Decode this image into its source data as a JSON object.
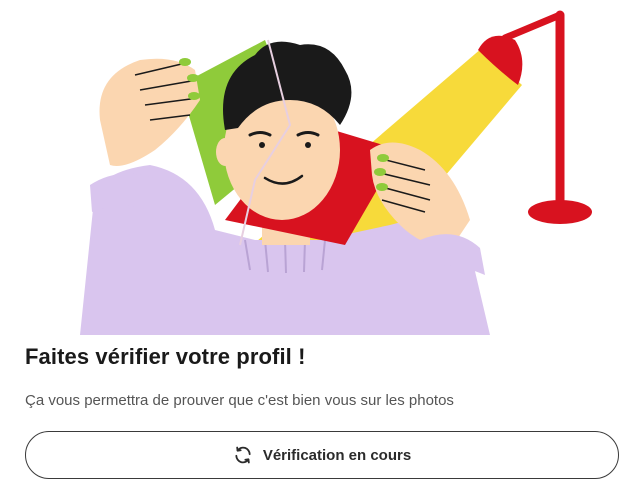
{
  "card": {
    "title": "Faites vérifier votre profil !",
    "subtitle": "Ça vous permettra de prouver que c'est bien vous sur les photos"
  },
  "status_button": {
    "label": "Vérification en cours",
    "icon": "refresh-icon"
  },
  "illustration": {
    "subject": "person-holding-photo-under-lamp",
    "colors": {
      "green": "#8fcb3a",
      "red": "#d8121f",
      "yellow": "#f7da3a",
      "lavender": "#d9c5ee",
      "skin": "#fbd6b0",
      "hair": "#1a1a1a",
      "lamp": "#d8121f"
    }
  }
}
